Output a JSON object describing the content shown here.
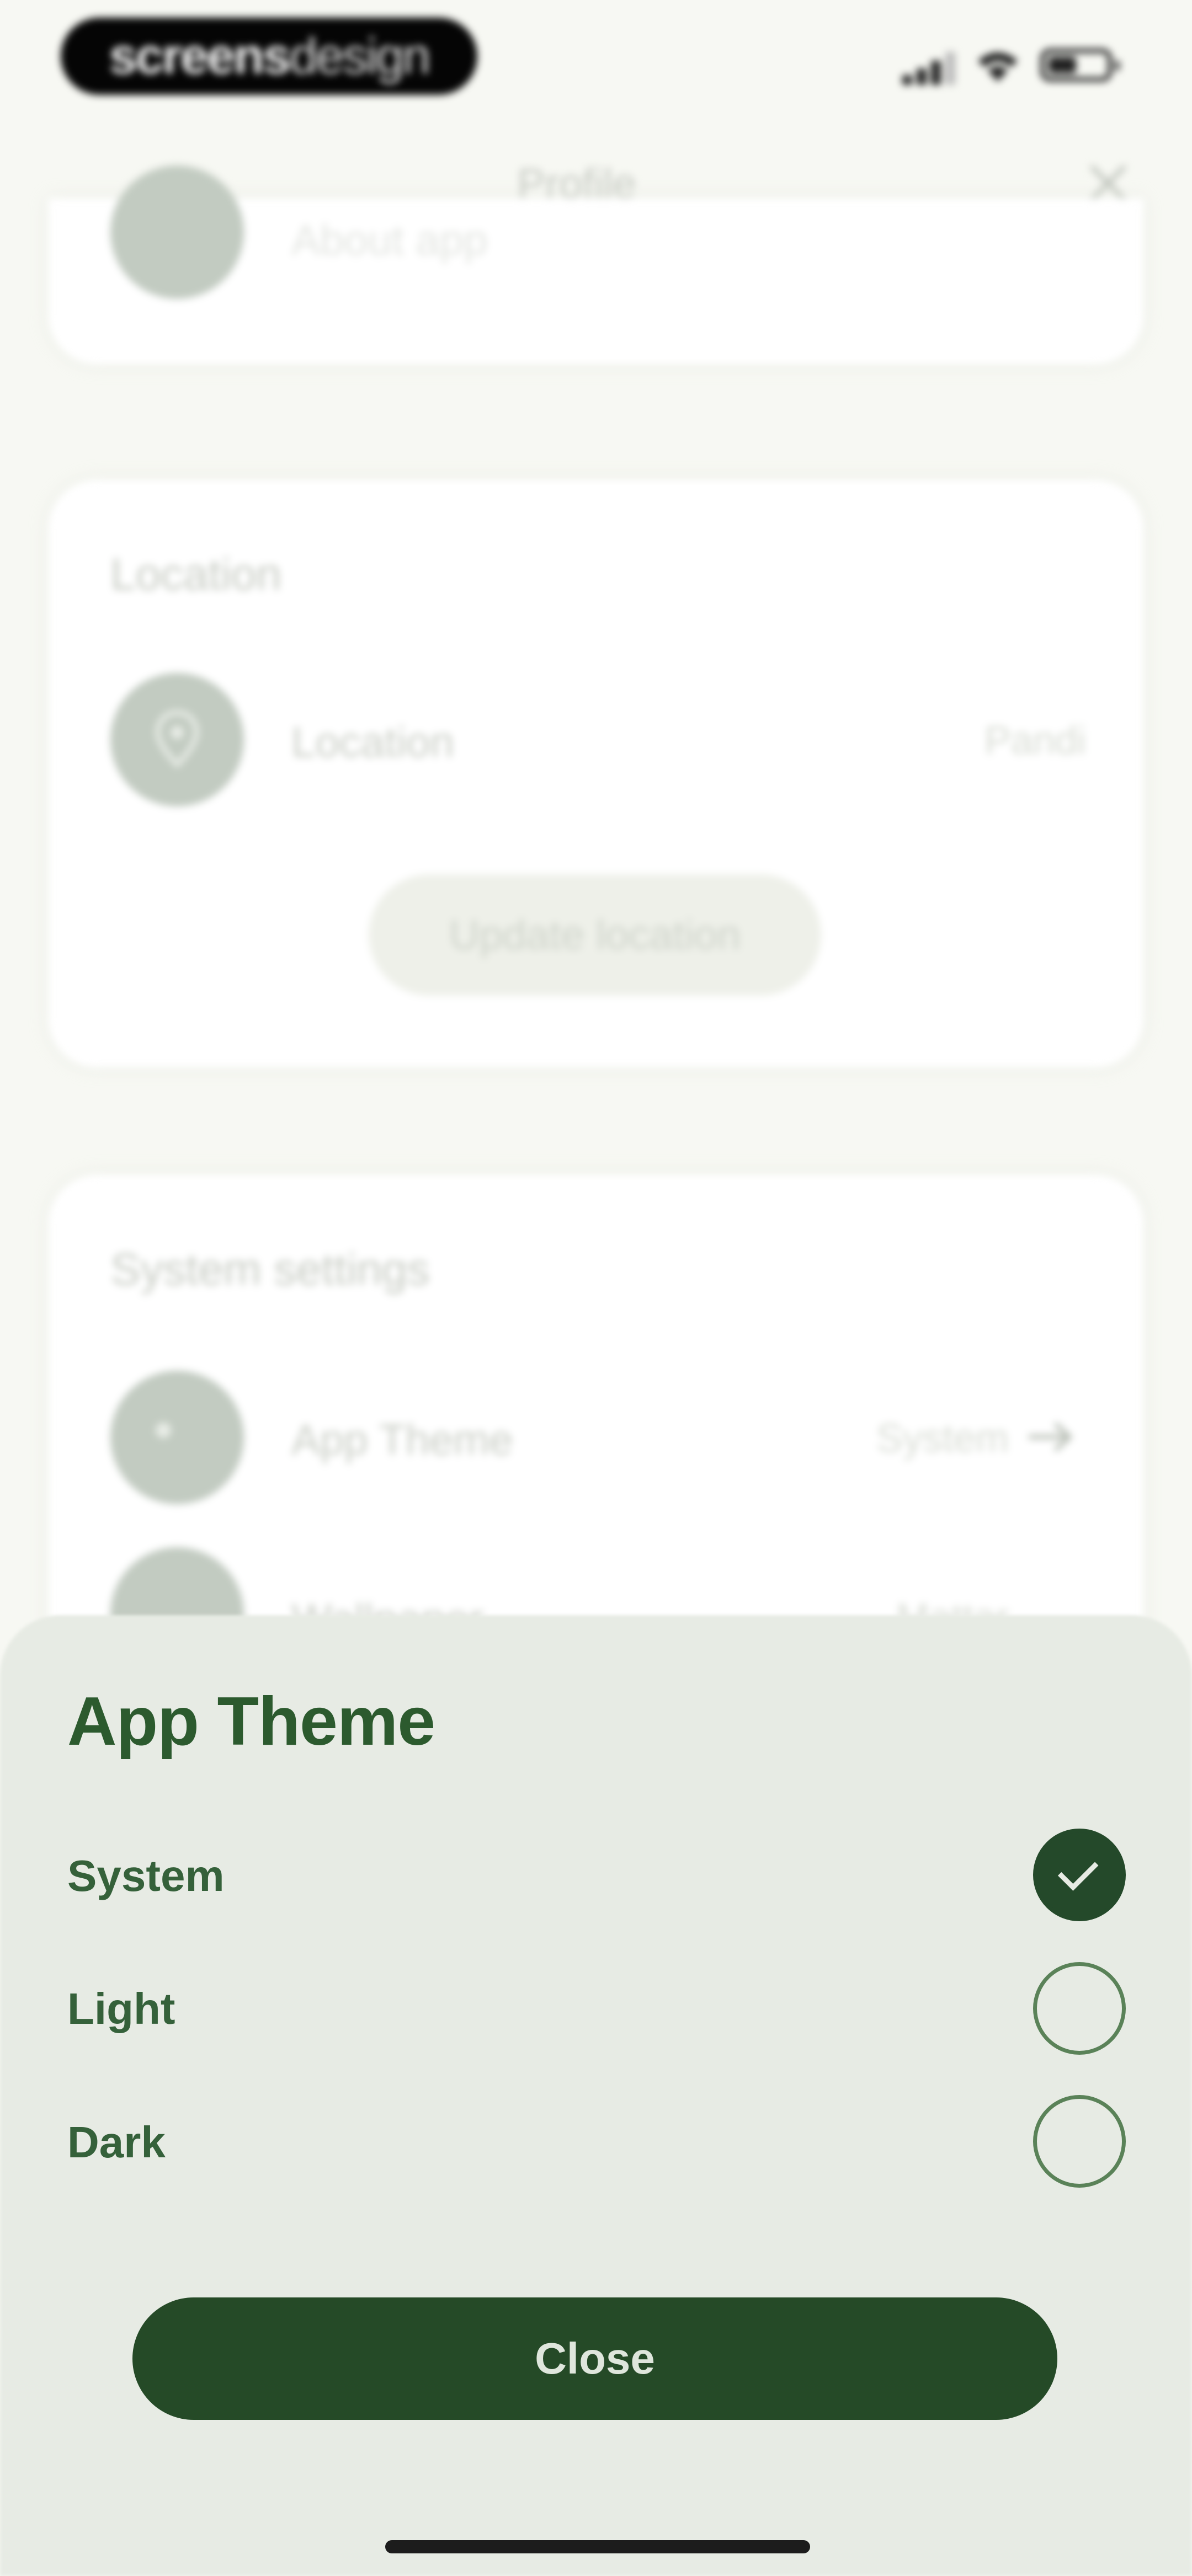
{
  "status_bar": {
    "brand_bold": "screens",
    "brand_light": "design"
  },
  "header": {
    "title": "Profile"
  },
  "card_partial": {
    "label": "About app"
  },
  "location_card": {
    "title": "Location",
    "row_label": "Location",
    "row_value": "Pandi",
    "button": "Update location"
  },
  "system_card": {
    "title": "System settings",
    "rows": [
      {
        "label": "App Theme",
        "value": "System"
      },
      {
        "label": "Wallpaper",
        "value": "Mattar"
      }
    ]
  },
  "sheet": {
    "title": "App Theme",
    "options": [
      {
        "label": "System",
        "selected": true
      },
      {
        "label": "Light",
        "selected": false
      },
      {
        "label": "Dark",
        "selected": false
      }
    ],
    "close_label": "Close"
  },
  "colors": {
    "accent": "#254a27",
    "sheet_bg": "#e7ebe4",
    "icon_bg": "#c2cbc1"
  }
}
